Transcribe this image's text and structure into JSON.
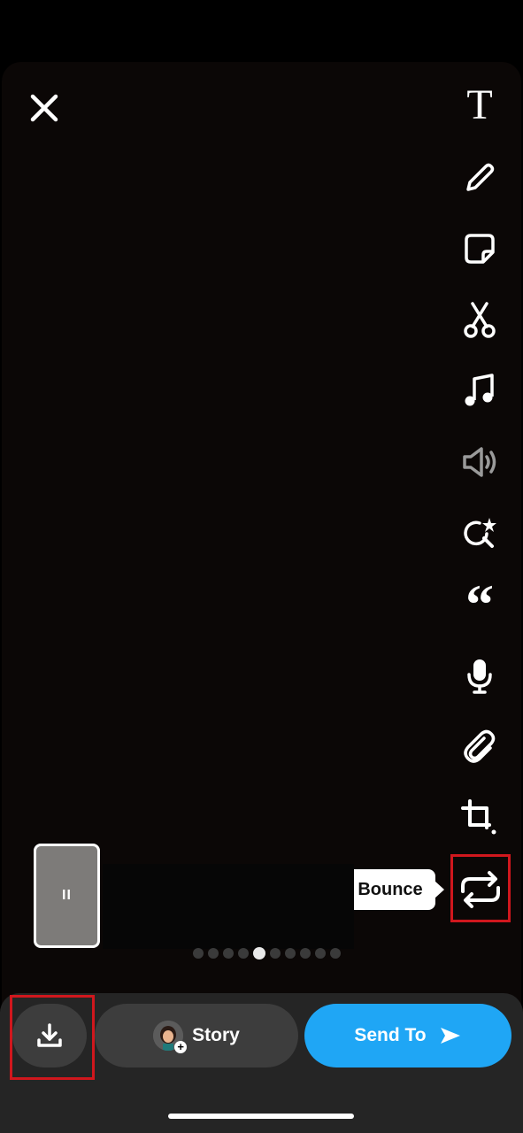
{
  "toolbar": {
    "text_tool_glyph": "T",
    "quote_tool_glyph": "“",
    "icons": [
      "text-icon",
      "pencil-icon",
      "sticker-icon",
      "scissors-icon",
      "music-icon",
      "volume-icon",
      "lens-sparkle-icon",
      "quote-icon",
      "microphone-icon",
      "paperclip-icon",
      "crop-icon",
      "bounce-loop-icon"
    ]
  },
  "tooltip": {
    "label": "Bounce"
  },
  "playback": {
    "pause_glyph": "II",
    "dot_count": 10,
    "active_dot_index": 4
  },
  "bottom": {
    "story_label": "Story",
    "avatar_plus": "+",
    "send_label": "Send To"
  },
  "colors": {
    "accent": "#1fa6f5",
    "highlight": "#d0171d",
    "background": "#0b0706"
  }
}
